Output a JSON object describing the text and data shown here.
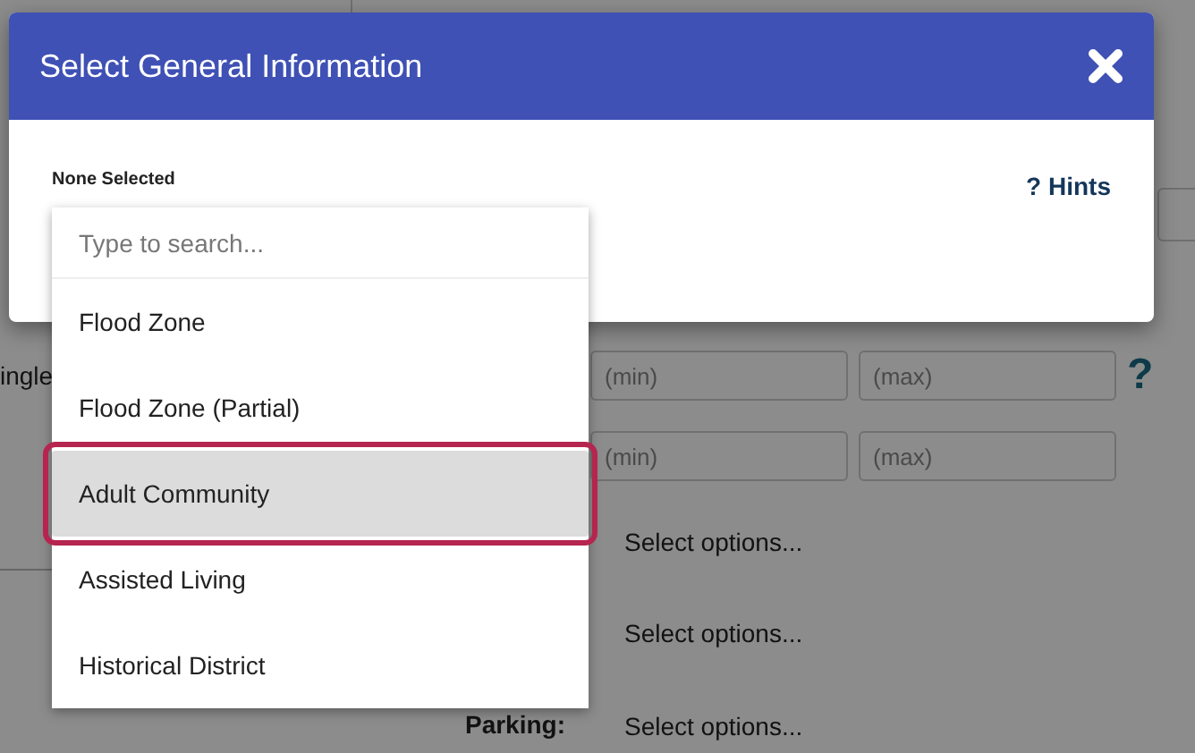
{
  "page": {
    "rows": [
      {
        "kind": "range",
        "label": "ingle",
        "fields": [
          {
            "placeholder": "(min)"
          },
          {
            "placeholder": "(max)"
          }
        ],
        "help": "?"
      },
      {
        "kind": "range",
        "fields": [
          {
            "placeholder": "(min)"
          },
          {
            "placeholder": "(max)"
          }
        ]
      },
      {
        "kind": "select",
        "value": "Select options..."
      },
      {
        "kind": "select",
        "value": "Select options..."
      },
      {
        "kind": "select",
        "label": "Parking:",
        "value": "Select options..."
      }
    ]
  },
  "modal": {
    "title": "Select General Information",
    "status": "None Selected",
    "hints": "? Hints"
  },
  "dropdown": {
    "placeholder": "Type to search...",
    "items": [
      {
        "label": "Flood Zone",
        "selected": false
      },
      {
        "label": "Flood Zone (Partial)",
        "selected": false
      },
      {
        "label": "Adult Community",
        "selected": true
      },
      {
        "label": "Assisted Living",
        "selected": false
      },
      {
        "label": "Historical District",
        "selected": false
      }
    ]
  }
}
